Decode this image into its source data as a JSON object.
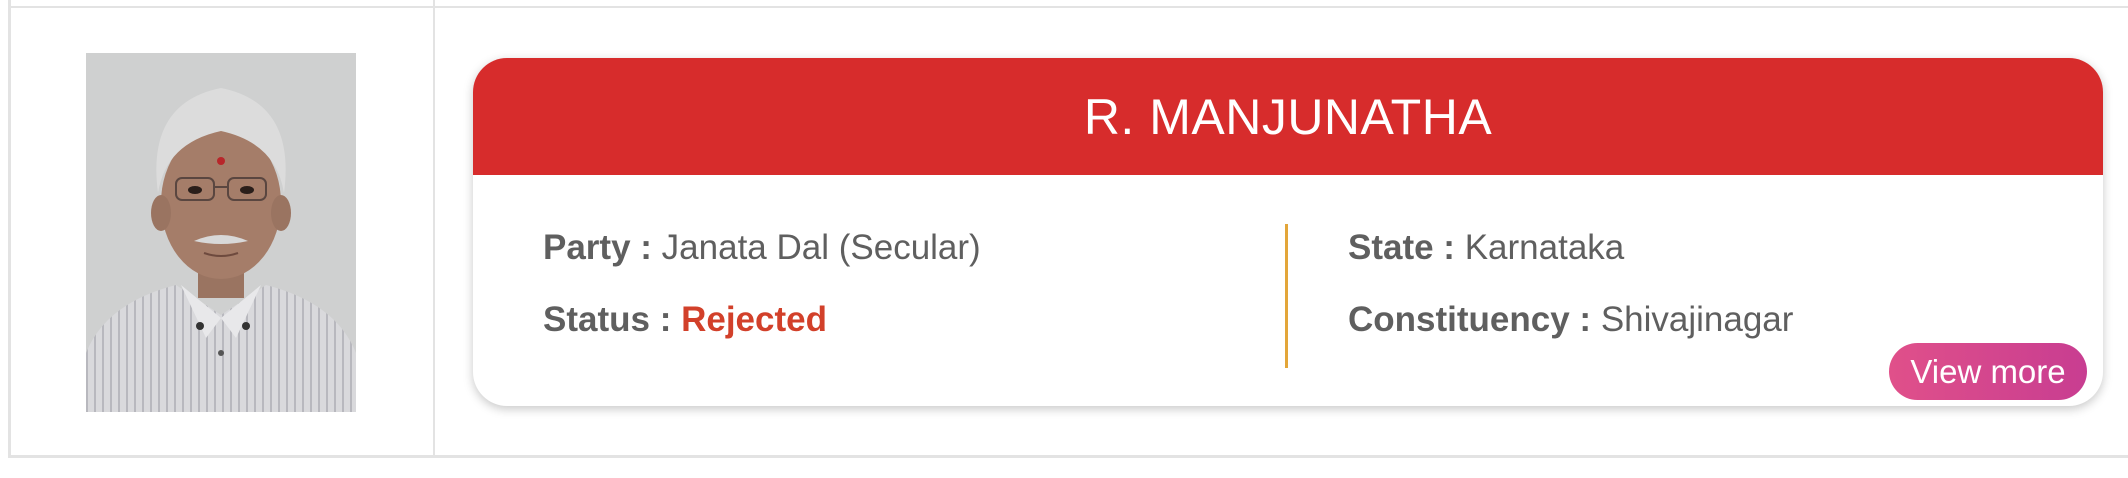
{
  "candidate": {
    "name": "R. MANJUNATHA",
    "party_label": "Party :",
    "party": "Janata Dal (Secular)",
    "status_label": "Status :",
    "status": "Rejected",
    "state_label": "State :",
    "state": "Karnataka",
    "constituency_label": "Constituency :",
    "constituency": "Shivajinagar",
    "view_more_label": "View more"
  },
  "colors": {
    "header": "#d72c2c",
    "status_rejected": "#d2402a",
    "divider": "#e3a63a",
    "button_gradient_start": "#e0508a",
    "button_gradient_end": "#c83d91"
  }
}
